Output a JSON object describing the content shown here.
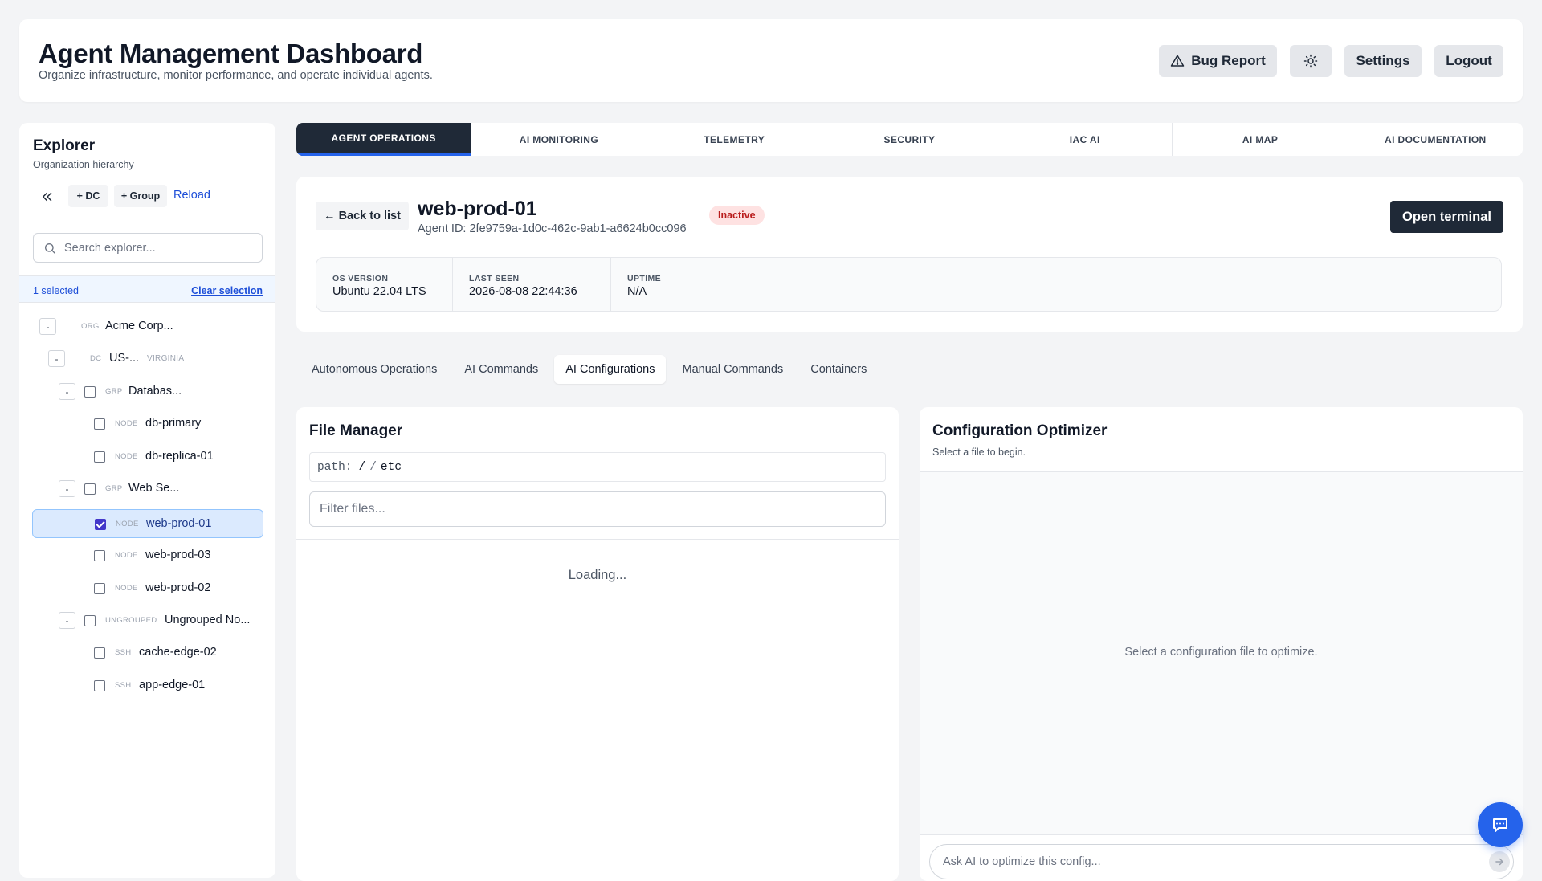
{
  "header": {
    "title": "Agent Management Dashboard",
    "subtitle": "Organize infrastructure, monitor performance, and operate individual agents.",
    "bug_report": "Bug Report",
    "settings": "Settings",
    "logout": "Logout"
  },
  "sidebar": {
    "title": "Explorer",
    "subtitle": "Organization hierarchy",
    "add_dc": "+ DC",
    "add_group": "+ Group",
    "reload": "Reload",
    "search_placeholder": "Search explorer...",
    "selected_count": "1 selected",
    "clear_selection": "Clear selection",
    "tree": [
      {
        "toggle": "-",
        "type": "ORG",
        "label": "Acme Corp..."
      },
      {
        "toggle": "-",
        "type": "DC",
        "label": "US-...",
        "sub": "VIRGINIA"
      },
      {
        "toggle": "-",
        "type": "GRP",
        "label": "Databas...",
        "checked": false
      },
      {
        "type": "NODE",
        "label": "db-primary",
        "checked": false
      },
      {
        "type": "NODE",
        "label": "db-replica-01",
        "checked": false
      },
      {
        "toggle": "-",
        "type": "GRP",
        "label": "Web Se...",
        "checked": false
      },
      {
        "type": "NODE",
        "label": "web-prod-01",
        "checked": true
      },
      {
        "type": "NODE",
        "label": "web-prod-03",
        "checked": false
      },
      {
        "type": "NODE",
        "label": "web-prod-02",
        "checked": false
      },
      {
        "toggle": "-",
        "type": "UNGROUPED",
        "label": "Ungrouped No...",
        "checked": false
      },
      {
        "type": "SSH",
        "label": "cache-edge-02",
        "checked": false
      },
      {
        "type": "SSH",
        "label": "app-edge-01",
        "checked": false
      }
    ]
  },
  "tabs": [
    {
      "label": "AGENT OPERATIONS",
      "active": true
    },
    {
      "label": "AI MONITORING"
    },
    {
      "label": "TELEMETRY"
    },
    {
      "label": "SECURITY"
    },
    {
      "label": "IAC AI"
    },
    {
      "label": "AI MAP"
    },
    {
      "label": "AI DOCUMENTATION"
    }
  ],
  "agent": {
    "back": "← Back to list",
    "name": "web-prod-01",
    "id": "Agent ID: 2fe9759a-1d0c-462c-9ab1-a6624b0cc096",
    "status": "Inactive",
    "open_terminal": "Open terminal",
    "stats": [
      {
        "label": "OS VERSION",
        "value": "Ubuntu 22.04 LTS"
      },
      {
        "label": "LAST SEEN",
        "value": "2026-08-08 22:44:36"
      },
      {
        "label": "UPTIME",
        "value": "N/A"
      }
    ]
  },
  "subtabs": [
    {
      "label": "Autonomous Operations"
    },
    {
      "label": "AI Commands"
    },
    {
      "label": "AI Configurations",
      "active": true
    },
    {
      "label": "Manual Commands"
    },
    {
      "label": "Containers"
    }
  ],
  "file_manager": {
    "title": "File Manager",
    "path_key": "path:",
    "path_root": "/",
    "path_sep": "/",
    "path_dir": "etc",
    "filter_placeholder": "Filter files...",
    "loading": "Loading..."
  },
  "optimizer": {
    "title": "Configuration Optimizer",
    "subtitle": "Select a file to begin.",
    "empty": "Select a configuration file to optimize.",
    "ask_placeholder": "Ask AI to optimize this config..."
  },
  "colors": {
    "accent": "#2563eb",
    "dark": "#1f2937",
    "danger_bg": "#fee2e2",
    "danger_text": "#b91c1c"
  }
}
